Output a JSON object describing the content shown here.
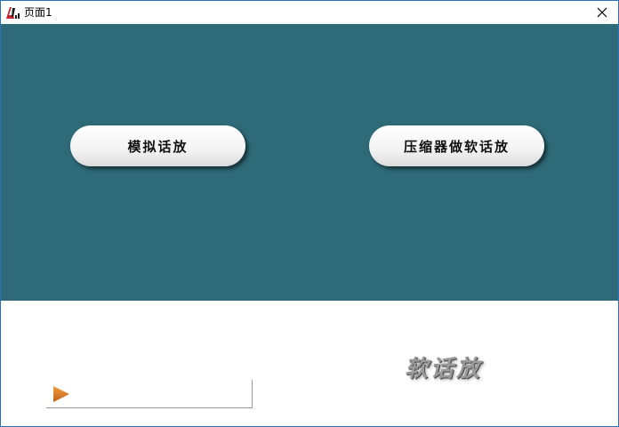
{
  "window": {
    "title": "页面1",
    "close_symbol": "✕",
    "app_icon": "app-logo-icon",
    "colors": {
      "stage_bg": "#2e6a77",
      "border": "#2a6fc0"
    }
  },
  "buttons": {
    "analog": "模拟话放",
    "compressor": "压缩器做软话放"
  },
  "footer": {
    "play_icon": "play-icon",
    "logo_text": "软话放"
  }
}
